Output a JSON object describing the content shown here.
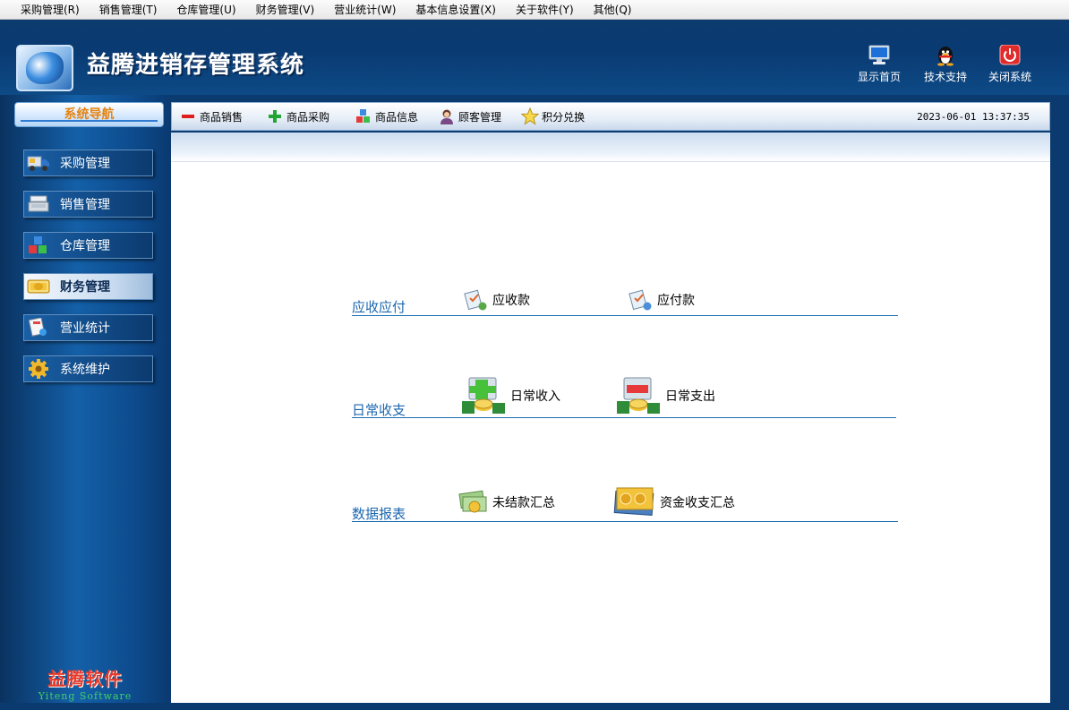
{
  "menu": [
    "采购管理(R)",
    "销售管理(T)",
    "仓库管理(U)",
    "财务管理(V)",
    "营业统计(W)",
    "基本信息设置(X)",
    "关于软件(Y)",
    "其他(Q)"
  ],
  "header": {
    "title": "益腾进销存管理系统",
    "buttons": [
      {
        "label": "显示首页",
        "icon": "monitor-icon"
      },
      {
        "label": "技术支持",
        "icon": "qq-penguin-icon"
      },
      {
        "label": "关闭系统",
        "icon": "power-icon"
      }
    ]
  },
  "sidebar": {
    "title": "系统导航",
    "items": [
      {
        "label": "采购管理",
        "icon": "truck-icon"
      },
      {
        "label": "销售管理",
        "icon": "cash-register-icon"
      },
      {
        "label": "仓库管理",
        "icon": "cubes-icon"
      },
      {
        "label": "财务管理",
        "icon": "money-icon",
        "active": true
      },
      {
        "label": "营业统计",
        "icon": "report-icon"
      },
      {
        "label": "系统维护",
        "icon": "gear-icon"
      }
    ],
    "brand_cn": "益腾软件",
    "brand_en": "Yiteng Software"
  },
  "toolbar": {
    "items": [
      {
        "label": "商品销售",
        "icon": "minus-icon"
      },
      {
        "label": "商品采购",
        "icon": "plus-icon"
      },
      {
        "label": "商品信息",
        "icon": "blocks-icon"
      },
      {
        "label": "顾客管理",
        "icon": "person-icon"
      },
      {
        "label": "积分兑换",
        "icon": "star-icon"
      }
    ],
    "datetime": "2023-06-01 13:37:35"
  },
  "content": {
    "sections": [
      {
        "label": "应收应付",
        "links": [
          {
            "label": "应收款",
            "icon": "receivable-icon"
          },
          {
            "label": "应付款",
            "icon": "payable-icon"
          }
        ]
      },
      {
        "label": "日常收支",
        "links": [
          {
            "label": "日常收入",
            "icon": "income-icon"
          },
          {
            "label": "日常支出",
            "icon": "expense-icon"
          }
        ]
      },
      {
        "label": "数据报表",
        "links": [
          {
            "label": "未结款汇总",
            "icon": "unsettled-icon"
          },
          {
            "label": "资金收支汇总",
            "icon": "fund-summary-icon"
          }
        ]
      }
    ]
  },
  "colors": {
    "header_bg": "#0c3b70",
    "accent": "#1b67b0",
    "nav_title": "#e8830f",
    "brand_red": "#e83a2a",
    "brand_green": "#3fd06a"
  }
}
